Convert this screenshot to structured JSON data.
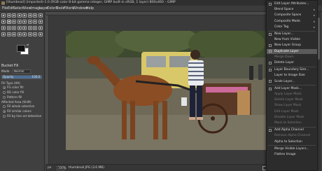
{
  "window": {
    "title": "[thumbnail] (imported)-1.0 (RGB color 8-bit gamma integer, GIMP built-in sRGB, 1 layer) 800x460 – GIMP"
  },
  "menubar": {
    "items": [
      "File",
      "Edit",
      "Select",
      "View",
      "Image",
      "Layer",
      "Colors",
      "Tools",
      "Filters",
      "Windows",
      "Help"
    ]
  },
  "tool_options": {
    "title": "Bucket Fill",
    "mode_label": "Mode",
    "mode_value": "Normal",
    "opacity_label": "Opacity",
    "opacity_value": "100.0",
    "opacity_fraction": 1.0,
    "fill_type_label": "Fill Type (Alt)",
    "fill_options": [
      "FG color fill",
      "BG color fill",
      "Pattern fill"
    ],
    "affected_area_label": "Affected Area (Shift)",
    "affected_options": [
      "Fill whole selection",
      "Fill similar colors",
      "Fill by line art detection"
    ]
  },
  "statusbar": {
    "unit": "px",
    "zoom": "100%",
    "file": "thumbnail.JPG (3.6 MB)"
  },
  "context_menu": {
    "items": [
      {
        "label": "Edit Layer Attributes...",
        "enabled": true,
        "icon": "edit-icon"
      },
      {
        "label": "Blend Space",
        "enabled": true,
        "submenu": true
      },
      {
        "label": "Composite Space",
        "enabled": true,
        "submenu": true
      },
      {
        "label": "Composite Mode",
        "enabled": true,
        "submenu": true
      },
      {
        "label": "Color Tag",
        "enabled": true,
        "submenu": true
      },
      {
        "label": "New Layer...",
        "enabled": true,
        "icon": "new-layer-icon"
      },
      {
        "label": "New from Visible",
        "enabled": true
      },
      {
        "label": "New Layer Group",
        "enabled": true,
        "icon": "folder-icon"
      },
      {
        "label": "Duplicate Layer",
        "enabled": true,
        "highlighted": true,
        "icon": "duplicate-icon"
      },
      {
        "label": "Merge Down",
        "enabled": false
      },
      {
        "label": "Delete Layer",
        "enabled": true,
        "icon": "delete-icon"
      },
      {
        "label": "Layer Boundary Size...",
        "enabled": true,
        "icon": "resize-icon"
      },
      {
        "label": "Layer to Image Size",
        "enabled": true
      },
      {
        "label": "Scale Layer...",
        "enabled": true,
        "icon": "scale-icon"
      },
      {
        "label": "Add Layer Mask...",
        "enabled": true,
        "icon": "mask-icon"
      },
      {
        "label": "Apply Layer Mask",
        "enabled": false
      },
      {
        "label": "Delete Layer Mask",
        "enabled": false
      },
      {
        "label": "Show Layer Mask",
        "enabled": false
      },
      {
        "label": "Edit Layer Mask",
        "enabled": false
      },
      {
        "label": "Disable Layer Mask",
        "enabled": false
      },
      {
        "label": "Mask to Selection",
        "enabled": false
      },
      {
        "label": "Add Alpha Channel",
        "enabled": true,
        "icon": "alpha-icon"
      },
      {
        "label": "Remove Alpha Channel",
        "enabled": false
      },
      {
        "label": "Alpha to Selection",
        "enabled": true
      },
      {
        "label": "Merge Visible Layers...",
        "enabled": true
      },
      {
        "label": "Flatten Image",
        "enabled": true
      }
    ]
  },
  "colors": {
    "menu_bg": "#2c2c2c",
    "highlight": "#5b5b5b",
    "accent": "#4d6f95"
  }
}
